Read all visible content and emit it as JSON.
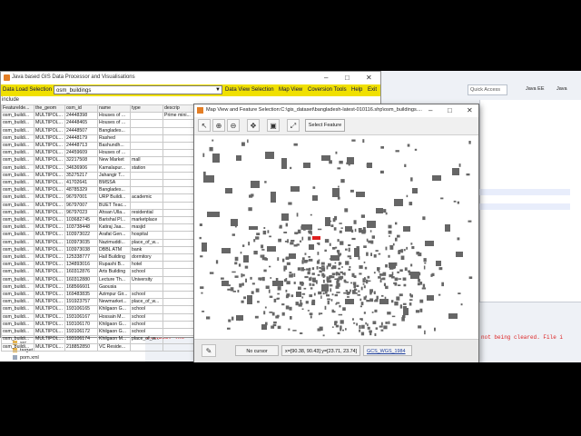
{
  "eclipse": {
    "quick_access": "Quick Access",
    "perspectives": [
      "Java EE",
      "Java"
    ],
    "console_warning": "WARNING: The",
    "console_warning_right": "not being cleared. File i",
    "tree": [
      "Maven Dependencies",
      "src",
      "target",
      "pom.xml"
    ]
  },
  "processor": {
    "title": "Java based GIS Data Processor and Visualisations",
    "menu": {
      "data_load": "Data Load Selection",
      "selected_layer": "osm_buildings",
      "data_view": "Data View Selection",
      "map_view": "Map View",
      "conversion": "Coversion Tools",
      "help": "Help",
      "exit": "Exit"
    },
    "include_label": "include",
    "columns": [
      "FeatureIde...",
      "the_geom",
      "osm_id",
      "name",
      "type",
      "descrip"
    ],
    "rows": [
      [
        "osm_buildi...",
        "MULTIPOL...",
        "24448398",
        "Houses of ...",
        "",
        "Prime mini..."
      ],
      [
        "osm_buildi...",
        "MULTIPOL...",
        "24448465",
        "Houses of ...",
        "",
        ""
      ],
      [
        "osm_buildi...",
        "MULTIPOL...",
        "24448507",
        "Banglades...",
        "",
        ""
      ],
      [
        "osm_buildi...",
        "MULTIPOL...",
        "24448179",
        "Rashed",
        "",
        ""
      ],
      [
        "osm_buildi...",
        "MULTIPOL...",
        "24448713",
        "Bashundh...",
        "",
        ""
      ],
      [
        "osm_buildi...",
        "MULTIPOL...",
        "24459609",
        "Houses of ...",
        "",
        ""
      ],
      [
        "osm_buildi...",
        "MULTIPOL...",
        "32217508",
        "New Market",
        "mall",
        ""
      ],
      [
        "osm_buildi...",
        "MULTIPOL...",
        "34636906",
        "Kamalapur...",
        "station",
        ""
      ],
      [
        "osm_buildi...",
        "MULTIPOL...",
        "35275217",
        "Jahangir T...",
        "",
        ""
      ],
      [
        "osm_buildi...",
        "MULTIPOL...",
        "41702641",
        "BMSSA",
        "",
        ""
      ],
      [
        "osm_buildi...",
        "MULTIPOL...",
        "48785329",
        "Banglades...",
        "",
        ""
      ],
      [
        "osm_buildi...",
        "MULTIPOL...",
        "96797001",
        "URP Buildi...",
        "academic",
        ""
      ],
      [
        "osm_buildi...",
        "MULTIPOL...",
        "96797007",
        "BUET Teac...",
        "",
        ""
      ],
      [
        "osm_buildi...",
        "MULTIPOL...",
        "96797023",
        "Ahsan Ulla...",
        "residential",
        ""
      ],
      [
        "osm_buildi...",
        "MULTIPOL...",
        "103682745",
        "Barishal Pl...",
        "marketplace",
        ""
      ],
      [
        "osm_buildi...",
        "MULTIPOL...",
        "103738448",
        "Katiraj Jaa...",
        "masjid",
        ""
      ],
      [
        "osm_buildi...",
        "MULTIPOL...",
        "103973022",
        "Arafat Gen...",
        "hospital",
        ""
      ],
      [
        "osm_buildi...",
        "MULTIPOL...",
        "103973035",
        "Nazimuddi...",
        "place_of_w...",
        ""
      ],
      [
        "osm_buildi...",
        "MULTIPOL...",
        "103973038",
        "DBBL ATM",
        "bank",
        ""
      ],
      [
        "osm_buildi...",
        "MULTIPOL...",
        "125338777",
        "Hall Building",
        "dormitory",
        ""
      ],
      [
        "osm_buildi...",
        "MULTIPOL...",
        "134893016",
        "Rupashi B...",
        "hotel",
        ""
      ],
      [
        "osm_buildi...",
        "MULTIPOL...",
        "160312876",
        "Arts Building",
        "school",
        ""
      ],
      [
        "osm_buildi...",
        "MULTIPOL...",
        "160312880",
        "Lecture Th...",
        "University",
        ""
      ],
      [
        "osm_buildi...",
        "MULTIPOL...",
        "168566601",
        "Gaousia",
        "",
        ""
      ],
      [
        "osm_buildi...",
        "MULTIPOL...",
        "169483835",
        "Azimpur Gir...",
        "school",
        ""
      ],
      [
        "osm_buildi...",
        "MULTIPOL...",
        "191923757",
        "Newmarket...",
        "place_of_w...",
        ""
      ],
      [
        "osm_buildi...",
        "MULTIPOL...",
        "193106165",
        "Khilgaon G...",
        "school",
        ""
      ],
      [
        "osm_buildi...",
        "MULTIPOL...",
        "193106167",
        "Hossain M...",
        "school",
        ""
      ],
      [
        "osm_buildi...",
        "MULTIPOL...",
        "193106170",
        "Khilgaon G...",
        "school",
        ""
      ],
      [
        "osm_buildi...",
        "MULTIPOL...",
        "193106172",
        "Khilgaon G...",
        "school",
        ""
      ],
      [
        "osm_buildi...",
        "MULTIPOL...",
        "193106174",
        "Khilgaon M...",
        "place_of_w...",
        ""
      ],
      [
        "osm_buildi...",
        "MULTIPOL...",
        "218852850",
        "VC Reside...",
        "",
        ""
      ]
    ]
  },
  "map": {
    "title": "Map View and Feature Selection:C:\\gis_dataset\\bangladesh-latest-010116.shp\\osm_buildings....",
    "select_feature": "Select Feature",
    "cursor": "No cursor",
    "extent": "x=[90.38, 90.43] y=[23.71, 23.74]",
    "crs": "GCS_WGS_1984",
    "feature_color": "#666666",
    "selected_color": "#e02020"
  }
}
